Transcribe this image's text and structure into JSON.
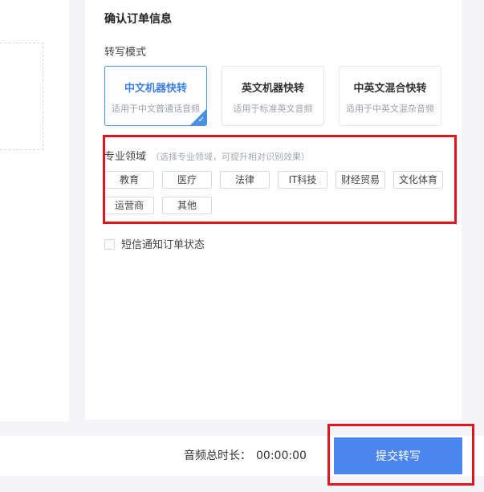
{
  "order": {
    "title": "确认订单信息",
    "mode_label": "转写模式",
    "modes": [
      {
        "name": "中文机器快转",
        "desc": "适用于中文普通话音频",
        "selected": true
      },
      {
        "name": "英文机器快转",
        "desc": "适用于标准英文音频",
        "selected": false
      },
      {
        "name": "中英文混合快转",
        "desc": "适用于中英文混杂音频",
        "selected": false
      }
    ],
    "domain": {
      "label": "专业领域",
      "hint": "（选择专业领域，可提升相对识别效果）",
      "tags": [
        "教育",
        "医疗",
        "法律",
        "IT科技",
        "财经贸易",
        "文化体育",
        "运营商",
        "其他"
      ]
    },
    "sms_label": "短信通知订单状态"
  },
  "footer": {
    "duration_label": "音频总时长：",
    "duration_value": "00:00:00",
    "submit_label": "提交转写"
  },
  "colors": {
    "accent": "#4a86ee",
    "highlight": "#e3141d"
  }
}
